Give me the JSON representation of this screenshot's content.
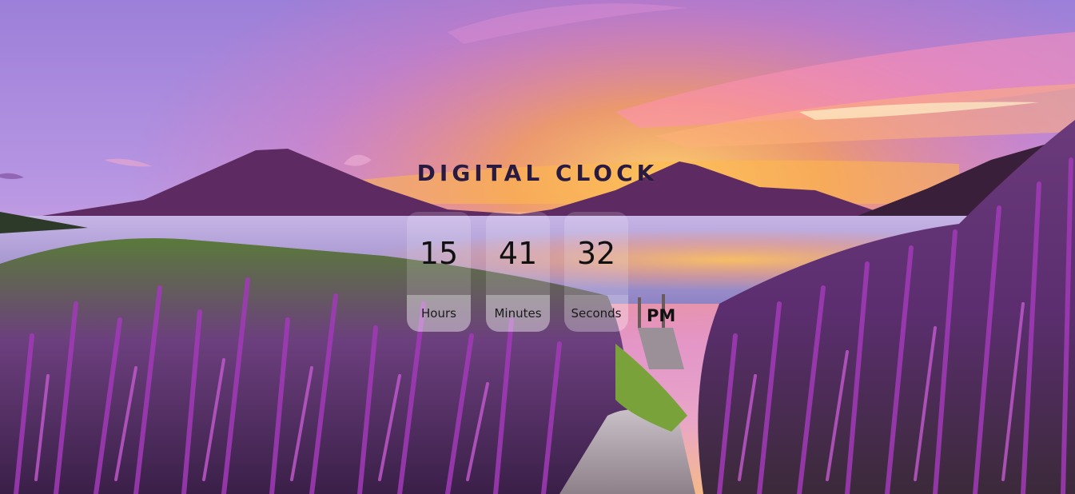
{
  "title": "DIGITAL CLOCK",
  "clock": {
    "hours": "15",
    "minutes": "41",
    "seconds": "32",
    "ampm": "PM",
    "labels": {
      "hours": "Hours",
      "minutes": "Minutes",
      "seconds": "Seconds"
    }
  },
  "background": {
    "description_colors": {
      "sky_top": "#9b7ad6",
      "sky_glow": "#ff9a3c",
      "mountain": "#5a2a5c",
      "lake": "#b9a6d8",
      "flowers": "#8a2a9c",
      "foliage": "#3e5a2a"
    }
  }
}
